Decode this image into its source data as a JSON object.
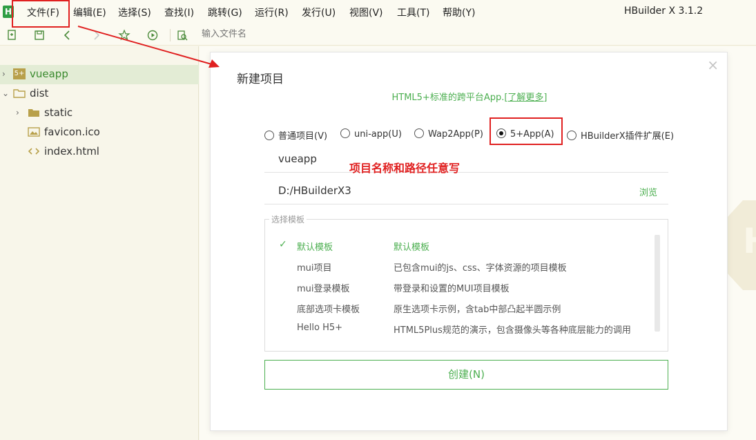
{
  "app": {
    "logo_text": "H",
    "title": "HBuilder X 3.1.2"
  },
  "menu": {
    "items": [
      "文件(F)",
      "编辑(E)",
      "选择(S)",
      "查找(I)",
      "跳转(G)",
      "运行(R)",
      "发行(U)",
      "视图(V)",
      "工具(T)",
      "帮助(Y)"
    ]
  },
  "toolbar": {
    "icons": [
      "new-file-icon",
      "save-icon",
      "back-icon",
      "forward-icon",
      "star-icon",
      "run-icon",
      "preview-icon"
    ],
    "search_placeholder": "输入文件名"
  },
  "sidebar": {
    "items": [
      {
        "label": "vueapp",
        "icon": "5+"
      },
      {
        "label": "dist"
      },
      {
        "label": "static"
      },
      {
        "label": "favicon.ico"
      },
      {
        "label": "index.html"
      }
    ]
  },
  "dialog": {
    "title": "新建项目",
    "subtitle": "HTML5+标准的跨平台App.",
    "learn_more": "[了解更多]",
    "close": "×",
    "project_types": [
      {
        "label": "普通项目(V)",
        "selected": false
      },
      {
        "label": "uni-app(U)",
        "selected": false
      },
      {
        "label": "Wap2App(P)",
        "selected": false
      },
      {
        "label": "5+App(A)",
        "selected": true
      },
      {
        "label": "HBuilderX插件扩展(E)",
        "selected": false
      }
    ],
    "project_name": "vueapp",
    "project_path": "D:/HBuilderX3",
    "browse_label": "浏览",
    "template_legend": "选择模板",
    "templates": [
      {
        "name": "默认模板",
        "desc": "默认模板",
        "selected": true
      },
      {
        "name": "mui项目",
        "desc": "已包含mui的js、css、字体资源的项目模板",
        "selected": false
      },
      {
        "name": "mui登录模板",
        "desc": "带登录和设置的MUI项目模板",
        "selected": false
      },
      {
        "name": "底部选项卡模板",
        "desc": "原生选项卡示例，含tab中部凸起半圆示例",
        "selected": false
      },
      {
        "name": "Hello H5+",
        "desc": "HTML5Plus规范的演示，包含摄像头等各种底层能力的调用",
        "selected": false
      }
    ],
    "create_label": "创建(N)"
  },
  "annotation": {
    "note": "项目名称和路径任意写",
    "color": "#e02020"
  },
  "colors": {
    "accent_green": "#4caf50",
    "sidebar_bg": "#f8f6ea",
    "selected_row": "#e3ecd5"
  },
  "watermark_text": "H"
}
